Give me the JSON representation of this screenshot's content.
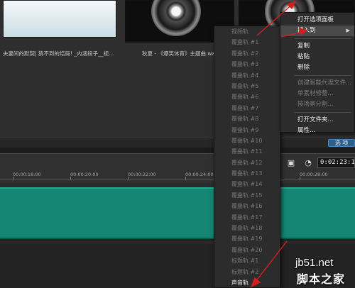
{
  "library": {
    "caption1": "夫妻间的默契| 猜不到的结局! _内涵段子__视...",
    "caption2": "秋夏 - 《爆笑体育》主题曲.wa..."
  },
  "options_button": "选 项",
  "timeline": {
    "ticks": [
      "00:00:18:00",
      "00:00:20:00",
      "00:00:22:00",
      "00:00:24:00",
      "00:00:28:00"
    ],
    "timecode": "0:02:23:19",
    "icons": [
      "film-icon",
      "clock-icon"
    ]
  },
  "submenu": {
    "items": [
      "视频轨",
      "覆叠轨 #1",
      "覆叠轨 #2",
      "覆叠轨 #3",
      "覆叠轨 #4",
      "覆叠轨 #5",
      "覆叠轨 #6",
      "覆叠轨 #7",
      "覆叠轨 #8",
      "覆叠轨 #9",
      "覆叠轨 #10",
      "覆叠轨 #11",
      "覆叠轨 #12",
      "覆叠轨 #13",
      "覆叠轨 #14",
      "覆叠轨 #15",
      "覆叠轨 #16",
      "覆叠轨 #17",
      "覆叠轨 #18",
      "覆叠轨 #19",
      "覆叠轨 #20",
      "标题轨 #1",
      "标题轨 #2",
      "声音轨"
    ],
    "active_index": 23
  },
  "context_menu": {
    "open_panel": "打开选项面板",
    "insert_to": "插入到",
    "copy": "复制",
    "paste": "粘贴",
    "delete": "删除",
    "smart_proxy": "创建智能代理文件...",
    "unlink": "单素材修整...",
    "split_scene": "按场景分割...",
    "open_folder": "打开文件夹...",
    "properties": "属性..."
  },
  "watermark": {
    "url": "jb51.net",
    "name": "脚本之家"
  },
  "colors": {
    "track": "#158673",
    "annotation": "#d41e1e",
    "options_button": "#2b5f8e"
  }
}
